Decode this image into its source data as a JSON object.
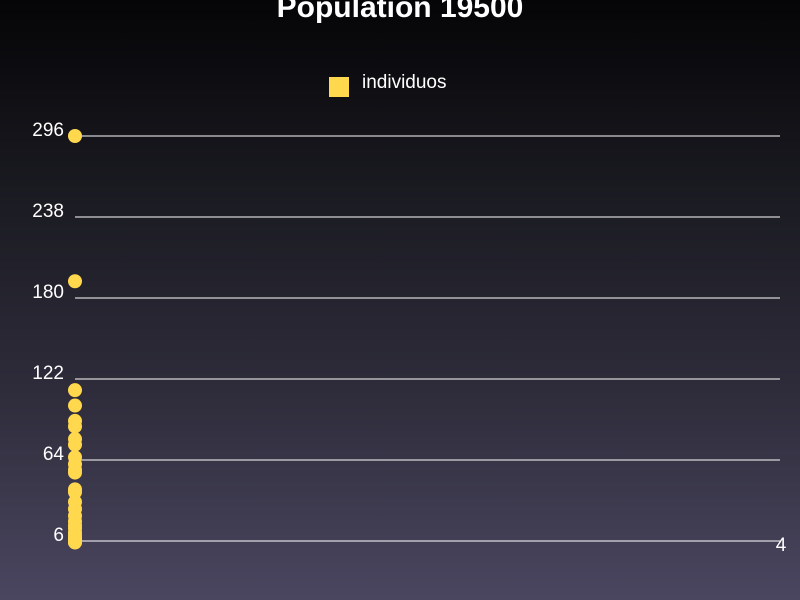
{
  "chart_data": {
    "type": "scatter",
    "title": "Population 19500",
    "legend": {
      "position": "top-center",
      "entries": [
        "individuos"
      ]
    },
    "series": [
      {
        "name": "individuos",
        "color": "#ffd84d",
        "x": [
          0,
          0,
          0,
          0,
          0,
          0,
          0,
          0,
          0,
          0,
          0,
          0,
          0,
          0,
          0,
          0,
          0,
          0,
          0,
          0,
          0,
          0,
          0,
          0,
          0,
          0,
          0
        ],
        "y": [
          296,
          192,
          114,
          103,
          92,
          88,
          79,
          75,
          66,
          61,
          57,
          55,
          43,
          41,
          34,
          29,
          24,
          20,
          17,
          15,
          12,
          10,
          8,
          7,
          6,
          5,
          5
        ]
      }
    ],
    "xlim": [
      0,
      4
    ],
    "ylim": [
      6,
      296
    ],
    "yticks": [
      "296",
      "238",
      "180",
      "122",
      "64",
      "6"
    ],
    "xtick_end": "4",
    "grid": true
  }
}
